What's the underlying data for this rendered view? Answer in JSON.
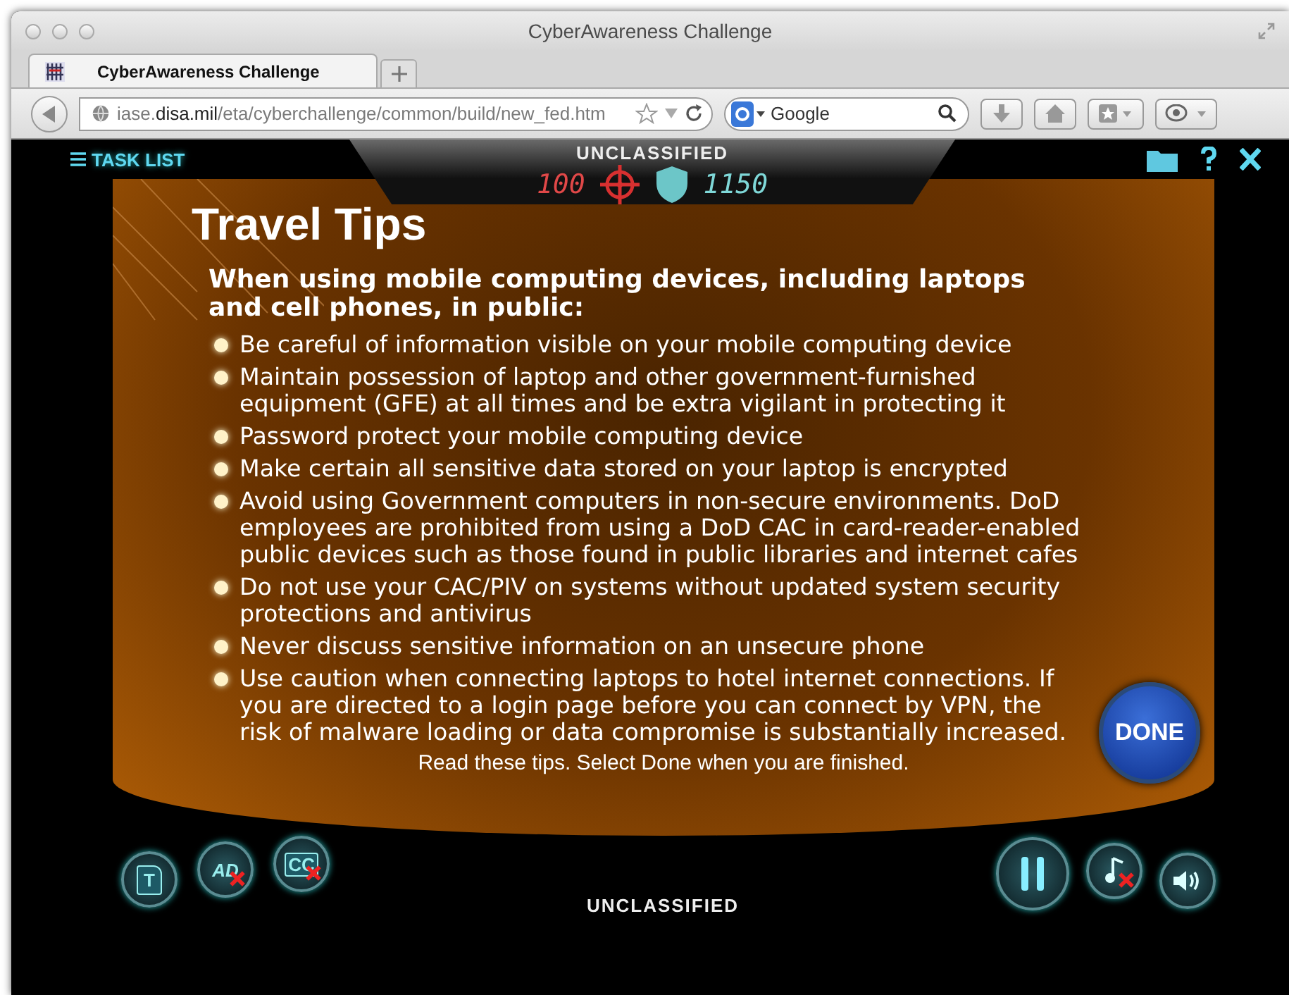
{
  "window": {
    "title": "CyberAwareness Challenge"
  },
  "tabs": [
    {
      "label": "CyberAwareness Challenge",
      "selected": true
    }
  ],
  "address_bar": {
    "url_start": "iase.",
    "url_domain": "disa.mil",
    "url_path": "/eta/cyberchallenge/common/build/new_fed.htm"
  },
  "search": {
    "placeholder": "Google"
  },
  "app": {
    "task_list": "TASK LIST",
    "classification_top": "UNCLASSIFIED",
    "score": "100",
    "points": "1150",
    "title": "Travel Tips",
    "heading": "When using mobile computing devices, including laptops and cell phones, in public:",
    "tips": [
      "Be careful of information visible on your mobile computing device",
      "Maintain possession of laptop and other government-furnished equipment (GFE) at all times and be extra vigilant in protecting it",
      "Password protect your mobile computing device",
      "Make certain all sensitive data stored on your laptop is encrypted",
      "Avoid using Government computers in non-secure environments. DoD employees are prohibited from using a DoD CAC in card-reader-enabled public devices such as those found in public libraries and internet cafes",
      "Do not use your CAC/PIV on systems without updated system security protections and antivirus",
      "Never discuss sensitive information on an unsecure phone",
      "Use caution when connecting laptops to hotel internet connections. If you are directed to a login page before you can connect by VPN, the risk of malware loading or data compromise is substantially increased."
    ],
    "instruction": "Read these tips. Select Done when you are finished.",
    "done_button": "DONE",
    "classification_bottom": "UNCLASSIFIED",
    "left_controls": [
      {
        "kind": "text",
        "label": "T",
        "on": true
      },
      {
        "kind": "audio",
        "label": "AD",
        "on": false
      },
      {
        "kind": "captions",
        "label": "CC",
        "on": false
      }
    ],
    "right_controls": [
      {
        "kind": "pause",
        "on": true
      },
      {
        "kind": "music",
        "on": false
      },
      {
        "kind": "volume",
        "on": true
      }
    ]
  }
}
